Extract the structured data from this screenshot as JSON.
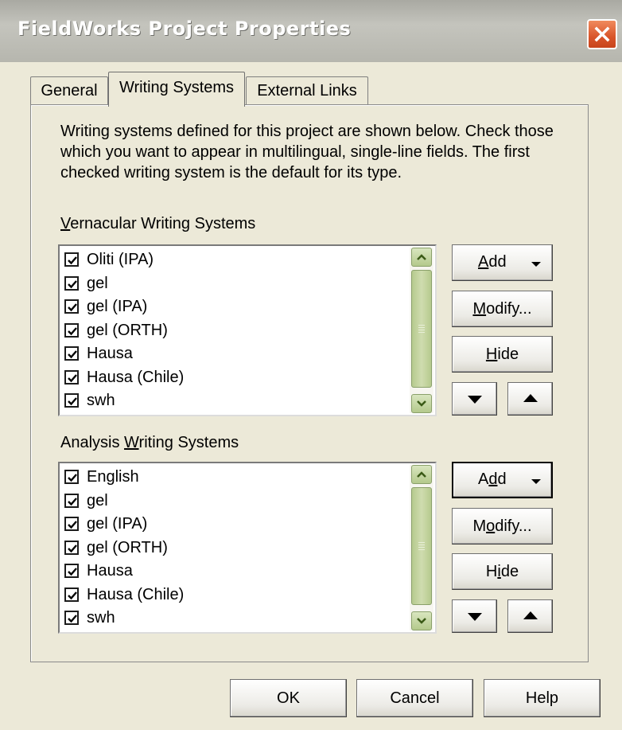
{
  "window": {
    "title": "FieldWorks Project Properties"
  },
  "tabs": [
    {
      "label": "General"
    },
    {
      "label": "Writing Systems"
    },
    {
      "label": "External Links"
    }
  ],
  "description": "Writing systems defined for this project are shown below. Check those which you want to appear in multilingual, single-line fields. The first checked writing system is the default for its type.",
  "vernacular": {
    "label_mnemonic": "V",
    "label_rest": "ernacular Writing Systems",
    "items": [
      {
        "label": "Oliti (IPA)",
        "checked": true
      },
      {
        "label": "gel",
        "checked": true
      },
      {
        "label": "gel (IPA)",
        "checked": true
      },
      {
        "label": "gel (ORTH)",
        "checked": true
      },
      {
        "label": "Hausa",
        "checked": true
      },
      {
        "label": "Hausa (Chile)",
        "checked": true
      },
      {
        "label": "swh",
        "checked": true
      }
    ],
    "add_mnemonic": "A",
    "add_rest": "dd",
    "modify_mnemonic": "M",
    "modify_rest": "odify...",
    "hide_mnemonic": "H",
    "hide_rest": "ide"
  },
  "analysis": {
    "label_before": "Analysis ",
    "label_mnemonic": "W",
    "label_rest": "riting Systems",
    "items": [
      {
        "label": "English",
        "checked": true
      },
      {
        "label": "gel",
        "checked": true
      },
      {
        "label": "gel (IPA)",
        "checked": true
      },
      {
        "label": "gel (ORTH)",
        "checked": true
      },
      {
        "label": "Hausa",
        "checked": true
      },
      {
        "label": "Hausa (Chile)",
        "checked": true
      },
      {
        "label": "swh",
        "checked": true
      }
    ],
    "add_before": "A",
    "add_mnemonic": "d",
    "add_rest": "d",
    "modify_before": "M",
    "modify_mnemonic": "o",
    "modify_rest": "dify...",
    "hide_before": "H",
    "hide_mnemonic": "i",
    "hide_rest": "de"
  },
  "footer": {
    "ok_label": "OK",
    "cancel_label": "Cancel",
    "help_label": "Help"
  }
}
